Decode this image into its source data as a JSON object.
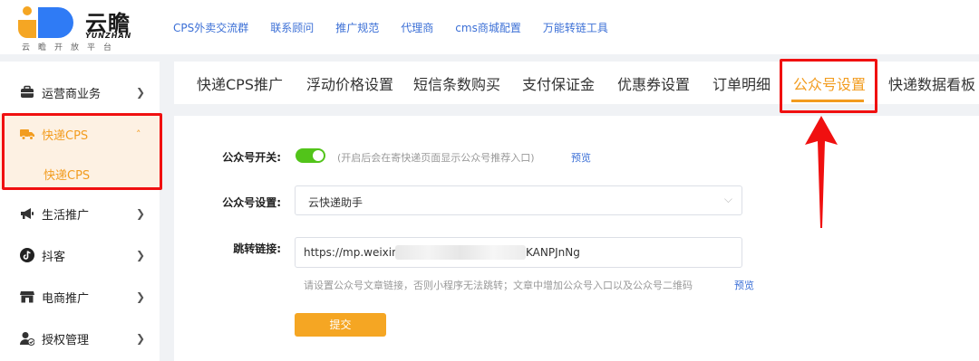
{
  "logo": {
    "name": "云瞻",
    "en": "YUNZHAN",
    "sub": "云瞻开放平台"
  },
  "topnav": [
    {
      "label": "CPS外卖交流群"
    },
    {
      "label": "联系顾问"
    },
    {
      "label": "推广规范"
    },
    {
      "label": "代理商"
    },
    {
      "label": "cms商城配置"
    },
    {
      "label": "万能转链工具"
    }
  ],
  "sidebar": {
    "items": [
      {
        "label": "运营商业务",
        "icon": "briefcase-icon"
      },
      {
        "label": "快递CPS",
        "icon": "truck-icon",
        "active": true
      },
      {
        "label": "生活推广",
        "icon": "megaphone-icon"
      },
      {
        "label": "抖客",
        "icon": "tiktok-icon"
      },
      {
        "label": "电商推广",
        "icon": "store-icon"
      },
      {
        "label": "授权管理",
        "icon": "user-check-icon"
      }
    ],
    "sub_item": "快递CPS"
  },
  "tabs": [
    {
      "label": "快递CPS推广"
    },
    {
      "label": "浮动价格设置"
    },
    {
      "label": "短信条数购买"
    },
    {
      "label": "支付保证金"
    },
    {
      "label": "优惠券设置"
    },
    {
      "label": "订单明细"
    },
    {
      "label": "公众号设置",
      "active": true
    },
    {
      "label": "快递数据看板"
    }
  ],
  "form": {
    "switch_label": "公众号开关:",
    "switch_on": true,
    "switch_hint": "(开启后会在寄快递页面显示公众号推荐入口)",
    "preview_label": "预览",
    "account_label": "公众号设置:",
    "account_value": "云快递助手",
    "link_label": "跳转链接:",
    "link_value_start": "https://mp.weixin.qq",
    "link_value_end": "KANPJnNg",
    "link_hint": "请设置公众号文章链接，否则小程序无法跳转；文章中增加公众号入口以及公众号二维码",
    "link_preview": "预览",
    "submit_label": "提交"
  },
  "colors": {
    "accent": "#f29c1f",
    "highlight": "#f01010",
    "link": "#3b6fd6",
    "toggle": "#52c41a"
  }
}
